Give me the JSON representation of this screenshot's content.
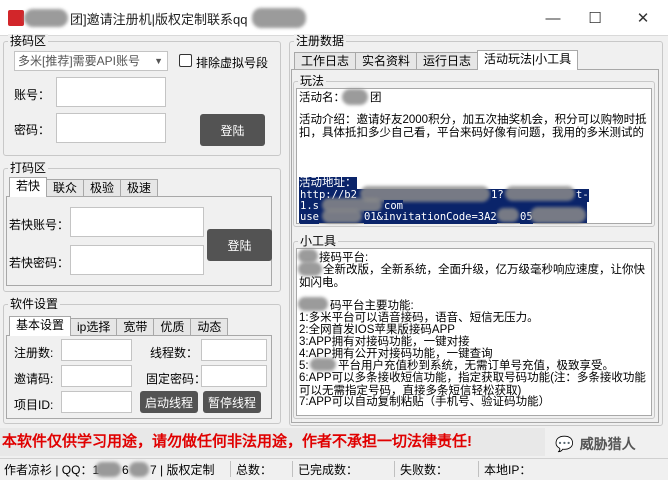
{
  "window": {
    "title_visible": "]邀请注册机|版权定制联系qq",
    "prefix_char": "团",
    "controls": {
      "minimize": "—",
      "maximize": "☐",
      "close": "✕"
    }
  },
  "jiema": {
    "group_title": "接码区",
    "api_select": "多米[推荐]需要API账号",
    "exclude_label": "排除虚拟号段",
    "account_label": "账号：",
    "password_label": "密码：",
    "login_button": "登陆"
  },
  "dama": {
    "group_title": "打码区",
    "tabs": [
      "若快",
      "联众",
      "极验",
      "极速"
    ],
    "account_label": "若快账号：",
    "password_label": "若快密码：",
    "login_button": "登陆"
  },
  "software": {
    "group_title": "软件设置",
    "tabs": [
      "基本设置",
      "ip选择",
      "宽带",
      "优质",
      "动态"
    ],
    "labels": {
      "registered": "注册数:",
      "threads": "线程数：",
      "invite_code": "邀请码:",
      "fixed_password": "固定密码：",
      "project_id": "项目ID:"
    },
    "start_button": "启动线程",
    "pause_button": "暂停线程"
  },
  "register": {
    "group_title": "注册数据",
    "tabs": [
      "工作日志",
      "实名资料",
      "运行日志",
      "活动玩法|小工具"
    ],
    "play_title": "玩法",
    "activity_name_label": "活动名：",
    "activity_name_suffix": "团",
    "intro": "活动介绍：邀请好友2000积分，加五次抽奖机会，积分可以购物时抵扣，具体抵扣多少自己看，平台来码好像有问题，我用的多米测试的",
    "address_label": "活动地址：",
    "url_line1": "http://b2",
    "url_line1_tail": "t-",
    "url_line1_q": "1?",
    "url_line2": "1.s",
    "url_line2_mid": "com",
    "url_line3_head": "use",
    "url_line3": "01&invitationCode=3A2",
    "url_line3_tail": "05"
  },
  "tools": {
    "group_title": "小工具",
    "platform_suffix": "接码平台:",
    "news": "全新改版，全新系统，全面升级，亿万级毫秒响应速度，让你快如闪电。",
    "features_title": "码平台主要功能:",
    "features": [
      "1:多米平台可以语音接码，语音、短信无压力。",
      "2:全网首发IOS苹果版接码APP",
      "3:APP拥有对接码功能，一键对接",
      "4:APP拥有公开对接码功能，一键查询",
      "5:",
      "6:APP可以多条接收短信功能，指定获取号码功能(注：多条接收功能可以无需指定号码，直接多条短信轻松获取)",
      "7:APP可以自动复制粘贴（手机号、验证码功能）"
    ],
    "feature5_text": "平台用户充值秒到系统，无需订单号充值，极致享受。"
  },
  "warning": "本软件仅供学习用途，请勿做任何非法用途，作者不承担一切法律责任!",
  "watermark": "威胁猎人",
  "status": {
    "author": "作者凉衫 | QQ：1",
    "author_mid": "6",
    "author_tail": "7 | 版权定制",
    "total": "总数：",
    "done": "已完成数：",
    "fail": "失败数：",
    "local_ip": "本地IP："
  }
}
